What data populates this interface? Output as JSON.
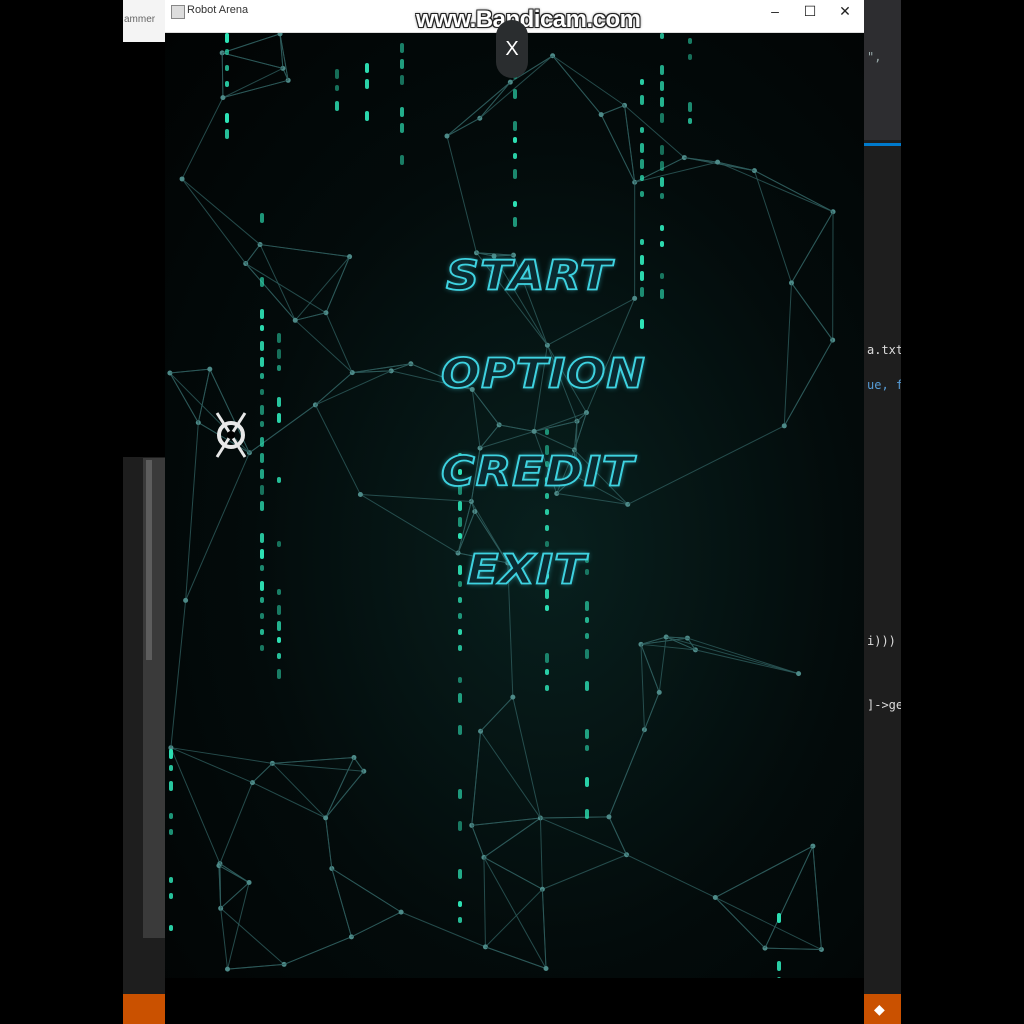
{
  "window": {
    "title": "Robot Arena",
    "watermark": "www.Bandicam.com",
    "minimize_icon": "–",
    "maximize_icon": "☐",
    "close_icon": "✕"
  },
  "overlay": {
    "close_label": "X"
  },
  "menu": {
    "items": [
      {
        "label": "START"
      },
      {
        "label": "OPTION"
      },
      {
        "label": "CREDIT"
      },
      {
        "label": "EXIT"
      }
    ]
  },
  "background_apps": {
    "left_tab_text": "ammer",
    "right_code_lines": [
      {
        "text": "\","
      },
      {
        "text": "a.txt"
      },
      {
        "text": "ue, f"
      },
      {
        "text": "i)))"
      },
      {
        "text": "]->ge"
      }
    ]
  },
  "colors": {
    "accent_cyan": "#3ed2e0",
    "matrix_green": "#2ee6b8",
    "network_line": "#2e5c5c",
    "editor_orange": "#ca5100"
  }
}
